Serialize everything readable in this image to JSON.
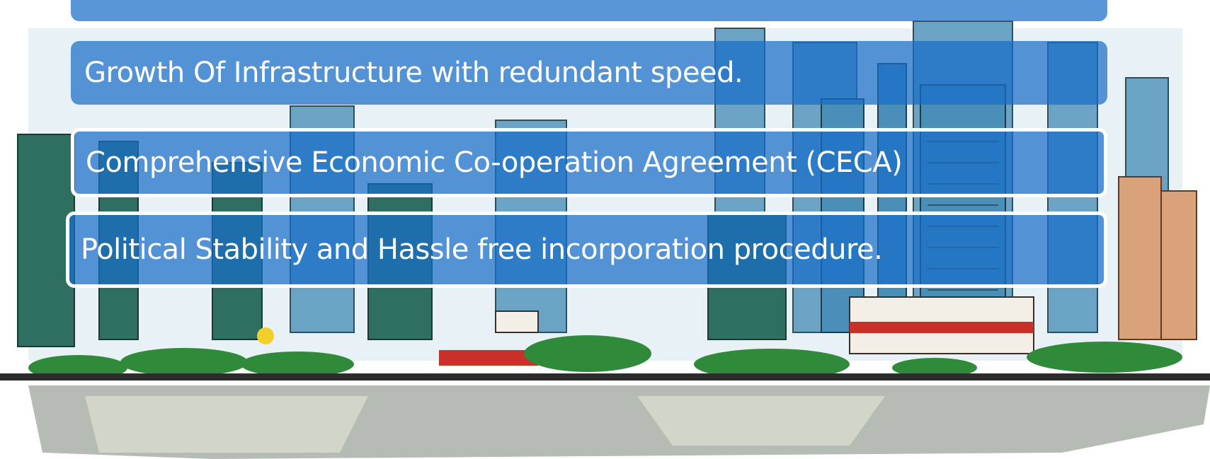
{
  "slide": {
    "items": [
      {
        "text": ""
      },
      {
        "text": "Growth Of Infrastructure with redundant speed."
      },
      {
        "text": "Comprehensive Economic Co-operation Agreement (CECA)"
      },
      {
        "text": "Political Stability and Hassle free incorporation procedure."
      }
    ]
  },
  "colors": {
    "bar_fill": "#1f6fc6",
    "bar_text": "#ffffff",
    "water": "#9aa49a",
    "foliage": "#2f8a3a",
    "buildings": "#3c7ea6",
    "accent_red": "#c8302a"
  }
}
